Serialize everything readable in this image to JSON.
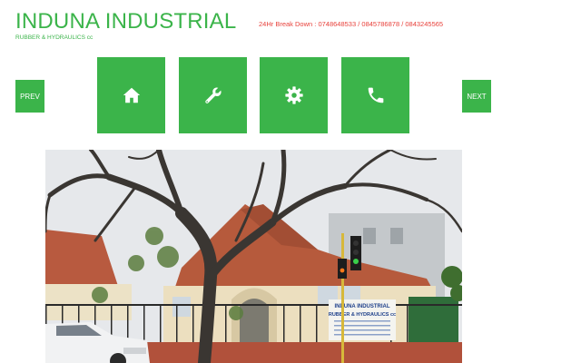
{
  "header": {
    "brand_name": "INDUNA INDUSTRIAL",
    "brand_tagline": "RUBBER & HYDRAULICS cc",
    "breakdown_text": "24Hr Break Down : 0748648533 / 0845786878 / 0843245565"
  },
  "carousel": {
    "prev_label": "PREV",
    "next_label": "NEXT"
  },
  "tiles": [
    {
      "icon": "home-icon"
    },
    {
      "icon": "wrench-icon"
    },
    {
      "icon": "gear-icon"
    },
    {
      "icon": "phone-icon"
    }
  ],
  "photo": {
    "sign_line1": "INDUNA INDUSTRIAL",
    "sign_line2": "RUBBER & HYDRAULICS cc"
  },
  "colors": {
    "accent_green": "#3bb44a",
    "breakdown_red": "#e8413b"
  }
}
